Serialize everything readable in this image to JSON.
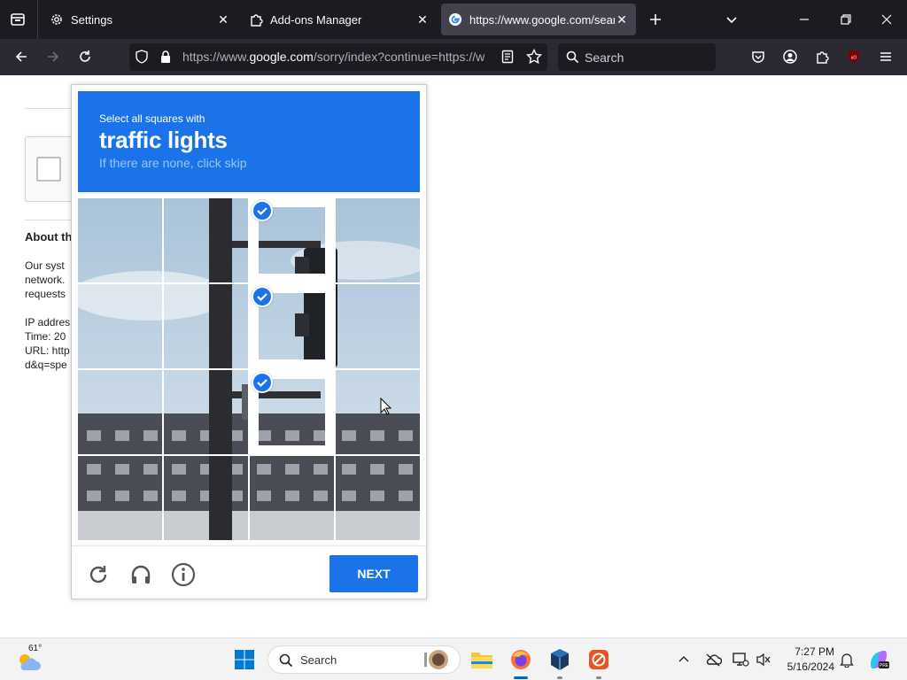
{
  "browser": {
    "tabs": [
      {
        "label": "Settings",
        "icon": "gear-icon"
      },
      {
        "label": "Add-ons Manager",
        "icon": "puzzle-icon"
      },
      {
        "label": "https://www.google.com/search",
        "icon": "google-icon"
      }
    ],
    "url": {
      "prefix": "https://www.",
      "domain": "google.com",
      "rest": "/sorry/index?continue=https://w"
    },
    "search_placeholder": "Search"
  },
  "background_page": {
    "about_heading": "About th",
    "lines": [
      "Our syst",
      "network.",
      "requests",
      "",
      "IP addres",
      "Time: 20",
      "URL: http",
      "d&q=spe"
    ]
  },
  "captcha": {
    "instruction_small": "Select all squares with",
    "target": "traffic lights",
    "hint": "If there are none, click skip",
    "grid": {
      "rows": 4,
      "cols": 4,
      "selected": [
        [
          0,
          2
        ],
        [
          1,
          2
        ],
        [
          2,
          2
        ]
      ]
    },
    "next_label": "NEXT",
    "header_color": "#1a73e8"
  },
  "taskbar": {
    "weather_temp": "61°",
    "search_label": "Search",
    "time": "7:27 PM",
    "date": "5/16/2024"
  }
}
